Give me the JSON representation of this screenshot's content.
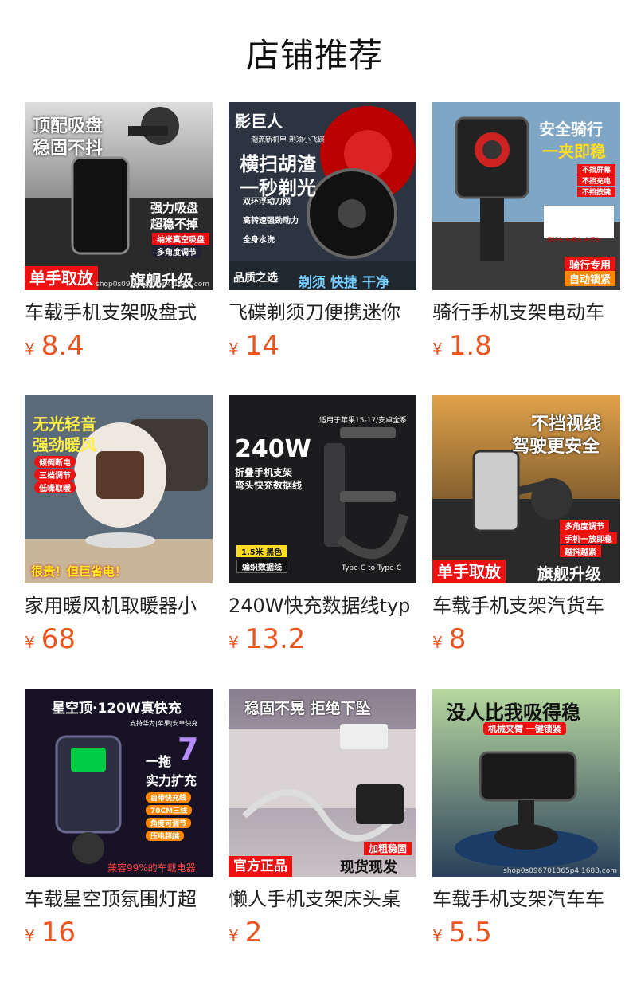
{
  "page": {
    "title": "店铺推荐"
  },
  "currency": "¥",
  "products": [
    {
      "name": "车载手机支架吸盘式",
      "price": "8.4",
      "overlay": [
        "顶配吸盘",
        "稳固不抖",
        "强力吸盘",
        "超稳不掉",
        "纳米真空吸盘",
        "多角度调节",
        "单手取放",
        "旗舰升级"
      ]
    },
    {
      "name": "飞碟剃须刀便携迷你",
      "price": "14",
      "overlay": [
        "影巨人",
        "潮流新机甲 剃须小飞碟",
        "横扫胡渣",
        "一秒剃光",
        "双环浮动刀网",
        "高转速强劲动力",
        "全身水洗",
        "品质之选",
        "剃须 快捷 干净"
      ]
    },
    {
      "name": "骑行手机支架电动车",
      "price": "1.8",
      "overlay": [
        "安全骑行",
        "一夹即稳",
        "不挡屏幕",
        "不挡充电",
        "不挡按键",
        "摩托车 电瓶车 自行车",
        "骑行专用",
        "自动锁紧"
      ]
    },
    {
      "name": "家用暖风机取暖器小",
      "price": "68",
      "overlay": [
        "无光轻音",
        "强劲暖风",
        "倾倒断电",
        "三档调节",
        "低噪取暖",
        "很贵！但巨省电！"
      ]
    },
    {
      "name": "240W快充数据线typ",
      "price": "13.2",
      "overlay": [
        "适用于苹果15-17/安卓全系",
        "240W",
        "折叠手机支架",
        "弯头快充数据线",
        "1.5米 黑色",
        "编织数据线",
        "Type-C to Type-C"
      ]
    },
    {
      "name": "车载手机支架汽货车",
      "price": "8",
      "overlay": [
        "不挡视线",
        "驾驶更安全",
        "多角度调节",
        "手机一放即稳",
        "越抖越紧",
        "单手取放",
        "旗舰升级"
      ]
    },
    {
      "name": "车载星空顶氛围灯超",
      "price": "16",
      "overlay": [
        "星空顶·120W真快充",
        "支持华为|苹果|安卓快充",
        "一拖",
        "7",
        "实力扩充",
        "自带快充线",
        "70CM三线",
        "角度可调节",
        "压电超越",
        "兼容99%的车载电器"
      ]
    },
    {
      "name": "懒人手机支架床头桌",
      "price": "2",
      "overlay": [
        "稳固不晃 拒绝下坠",
        "加粗稳固",
        "官方正品",
        "现货现发"
      ]
    },
    {
      "name": "车载手机支架汽车车",
      "price": "5.5",
      "overlay": [
        "没人比我吸得稳",
        "机械夹臂 一键锁紧"
      ]
    }
  ],
  "watermark": "shop0s096701365p4.1688.com",
  "colors": {
    "price": "#e8551e",
    "accent_red": "#e11111"
  }
}
